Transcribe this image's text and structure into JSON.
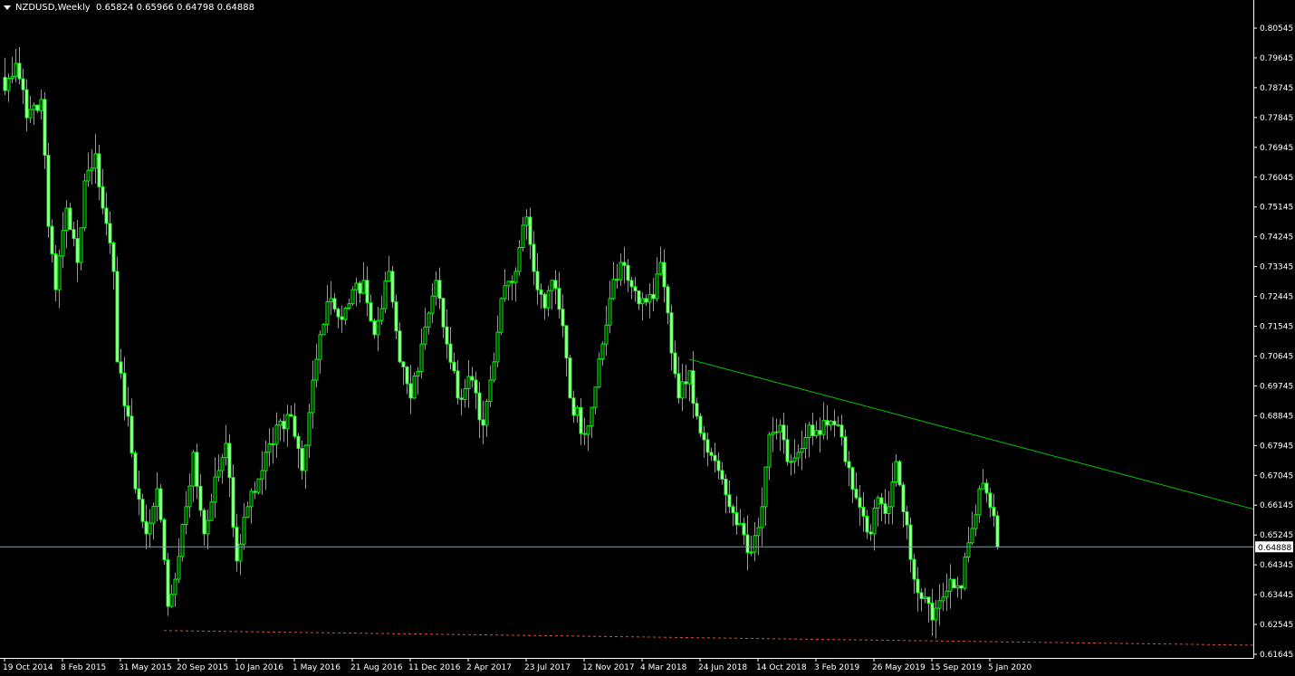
{
  "header": {
    "symbol_timeframe": "NZDUSD,Weekly",
    "ohlc_text": "0.65824 0.65966 0.64798 0.64888"
  },
  "colors": {
    "background": "#000000",
    "candle": "#00ff00",
    "bear_fill": "#e8ffe8",
    "bid_line": "#8899aa",
    "trendline": "#00c800",
    "support_line": "#ff4030",
    "axis": "#ffffff"
  },
  "chart_data": {
    "type": "candlestick",
    "title": "NZDUSD,Weekly",
    "ylim": [
      0.61645,
      0.80545
    ],
    "y_ticks": [
      "0.80545",
      "0.79645",
      "0.78745",
      "0.77845",
      "0.76945",
      "0.76045",
      "0.75145",
      "0.74245",
      "0.73345",
      "0.72445",
      "0.71545",
      "0.70645",
      "0.69745",
      "0.68845",
      "0.67945",
      "0.67045",
      "0.66145",
      "0.65245",
      "0.64345",
      "0.63445",
      "0.62545",
      "0.61645"
    ],
    "x_labels": [
      "19 Oct 2014",
      "8 Feb 2015",
      "31 May 2015",
      "20 Sep 2015",
      "10 Jan 2016",
      "1 May 2016",
      "21 Aug 2016",
      "11 Dec 2016",
      "2 Apr 2017",
      "23 Jul 2017",
      "12 Nov 2017",
      "4 Mar 2018",
      "24 Jun 2018",
      "14 Oct 2018",
      "3 Feb 2019",
      "26 May 2019",
      "15 Sep 2019",
      "5 Jan 2020"
    ],
    "x_label_interval_weeks": 16,
    "close_keypoints_week_price": [
      [
        0,
        0.7866
      ],
      [
        3,
        0.7948
      ],
      [
        6,
        0.7784
      ],
      [
        10,
        0.7839
      ],
      [
        12,
        0.7456
      ],
      [
        14,
        0.7265
      ],
      [
        17,
        0.7511
      ],
      [
        20,
        0.7347
      ],
      [
        22,
        0.7593
      ],
      [
        25,
        0.7675
      ],
      [
        27,
        0.7511
      ],
      [
        30,
        0.732
      ],
      [
        31,
        0.7047
      ],
      [
        34,
        0.6883
      ],
      [
        36,
        0.6664
      ],
      [
        39,
        0.6528
      ],
      [
        42,
        0.6664
      ],
      [
        45,
        0.6309
      ],
      [
        47,
        0.6391
      ],
      [
        50,
        0.661
      ],
      [
        52,
        0.6774
      ],
      [
        55,
        0.6528
      ],
      [
        59,
        0.6719
      ],
      [
        61,
        0.6801
      ],
      [
        64,
        0.6446
      ],
      [
        67,
        0.661
      ],
      [
        71,
        0.6719
      ],
      [
        75,
        0.6856
      ],
      [
        79,
        0.6883
      ],
      [
        82,
        0.6719
      ],
      [
        85,
        0.6992
      ],
      [
        87,
        0.7129
      ],
      [
        90,
        0.7238
      ],
      [
        92,
        0.7183
      ],
      [
        96,
        0.7265
      ],
      [
        99,
        0.7293
      ],
      [
        102,
        0.7129
      ],
      [
        106,
        0.732
      ],
      [
        109,
        0.7047
      ],
      [
        112,
        0.6938
      ],
      [
        115,
        0.7101
      ],
      [
        119,
        0.7293
      ],
      [
        122,
        0.7101
      ],
      [
        125,
        0.6938
      ],
      [
        129,
        0.6992
      ],
      [
        132,
        0.6856
      ],
      [
        135,
        0.7047
      ],
      [
        137,
        0.7238
      ],
      [
        141,
        0.732
      ],
      [
        144,
        0.7484
      ],
      [
        146,
        0.732
      ],
      [
        149,
        0.721
      ],
      [
        151,
        0.7293
      ],
      [
        154,
        0.7156
      ],
      [
        156,
        0.6938
      ],
      [
        160,
        0.6828
      ],
      [
        162,
        0.691
      ],
      [
        165,
        0.7101
      ],
      [
        167,
        0.7238
      ],
      [
        170,
        0.7347
      ],
      [
        172,
        0.7293
      ],
      [
        176,
        0.7238
      ],
      [
        179,
        0.7238
      ],
      [
        181,
        0.7347
      ],
      [
        184,
        0.7074
      ],
      [
        186,
        0.6938
      ],
      [
        189,
        0.702
      ],
      [
        191,
        0.6883
      ],
      [
        194,
        0.6774
      ],
      [
        197,
        0.6719
      ],
      [
        200,
        0.661
      ],
      [
        202,
        0.6555
      ],
      [
        206,
        0.6473
      ],
      [
        209,
        0.661
      ],
      [
        211,
        0.6828
      ],
      [
        214,
        0.6856
      ],
      [
        216,
        0.6746
      ],
      [
        219,
        0.6774
      ],
      [
        222,
        0.6856
      ],
      [
        225,
        0.6828
      ],
      [
        227,
        0.6856
      ],
      [
        230,
        0.6856
      ],
      [
        232,
        0.6746
      ],
      [
        235,
        0.6637
      ],
      [
        239,
        0.6528
      ],
      [
        241,
        0.6637
      ],
      [
        244,
        0.661
      ],
      [
        246,
        0.6746
      ],
      [
        249,
        0.6555
      ],
      [
        251,
        0.6391
      ],
      [
        254,
        0.6337
      ],
      [
        256,
        0.6268
      ],
      [
        259,
        0.6337
      ],
      [
        261,
        0.6391
      ],
      [
        264,
        0.6364
      ],
      [
        266,
        0.6501
      ],
      [
        269,
        0.6664
      ],
      [
        271,
        0.6651
      ],
      [
        273,
        0.65824
      ]
    ],
    "last_candle": {
      "open": 0.65824,
      "high": 0.65966,
      "low": 0.64798,
      "close": 0.64888
    },
    "bid_price": "0.64888",
    "trendline": {
      "start": [
        189,
        0.7055
      ],
      "end": [
        345,
        0.6602
      ]
    },
    "support_line": {
      "start": [
        44,
        0.6236
      ],
      "end": [
        345,
        0.6192
      ]
    }
  }
}
